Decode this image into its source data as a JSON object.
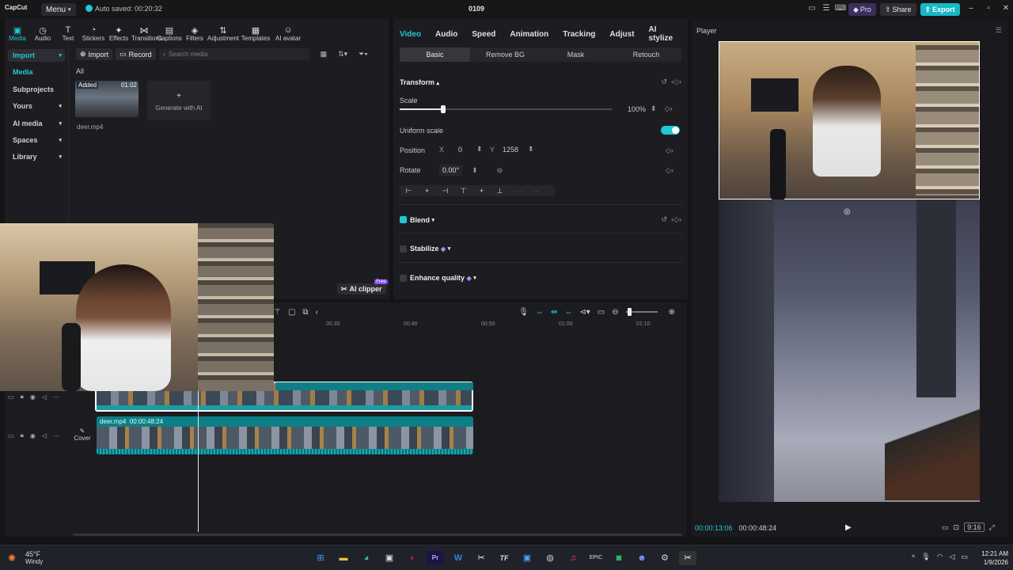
{
  "titlebar": {
    "logo": "CapCut",
    "menu_label": "Menu",
    "autosave": "Auto saved: 00:20:32",
    "project_title": "0109",
    "pro_label": "Pro",
    "share_label": "Share",
    "export_label": "Export"
  },
  "toolbar": [
    {
      "label": "Media",
      "icon": "media-icon"
    },
    {
      "label": "Audio",
      "icon": "audio-icon"
    },
    {
      "label": "Text",
      "icon": "text-icon"
    },
    {
      "label": "Stickers",
      "icon": "stickers-icon"
    },
    {
      "label": "Effects",
      "icon": "effects-icon"
    },
    {
      "label": "Transitions",
      "icon": "transitions-icon"
    },
    {
      "label": "Captions",
      "icon": "captions-icon"
    },
    {
      "label": "Filters",
      "icon": "filters-icon"
    },
    {
      "label": "Adjustment",
      "icon": "adjustment-icon"
    },
    {
      "label": "Templates",
      "icon": "templates-icon"
    },
    {
      "label": "AI avatar",
      "icon": "ai-avatar-icon"
    }
  ],
  "sidenav": {
    "import": "Import",
    "media": "Media",
    "subprojects": "Subprojects",
    "yours": "Yours",
    "ai_media": "AI media",
    "spaces": "Spaces",
    "library": "Library"
  },
  "media": {
    "import_btn": "Import",
    "record_btn": "Record",
    "search_placeholder": "Search media",
    "filter_all": "All",
    "clip_badge": "Added",
    "clip_duration": "01:02",
    "clip_name": "deer.mp4",
    "generate_ai": "Generate with AI",
    "ai_clipper": "AI clipper",
    "free_badge": "Free"
  },
  "props": {
    "tabs": [
      "Video",
      "Audio",
      "Speed",
      "Animation",
      "Tracking",
      "Adjust",
      "AI stylize"
    ],
    "subtabs": [
      "Basic",
      "Remove BG",
      "Mask",
      "Retouch"
    ],
    "transform": "Transform",
    "scale_label": "Scale",
    "scale_value": "100%",
    "uniform_scale": "Uniform scale",
    "position_label": "Position",
    "x_label": "X",
    "x_value": "0",
    "y_label": "Y",
    "y_value": "1258",
    "rotate_label": "Rotate",
    "rotate_value": "0.00°",
    "blend": "Blend",
    "stabilize": "Stabilize",
    "enhance_quality": "Enhance quality"
  },
  "player": {
    "title": "Player",
    "current_time": "00:00:13:06",
    "total_time": "00:00:48:24",
    "ratio": "9:16"
  },
  "timeline": {
    "ruler": [
      "00:30",
      "00:40",
      "00:50",
      "01:00",
      "01:10"
    ],
    "clip_label": "deer.mp4",
    "clip_duration": "00:00:48:24",
    "cover_label": "Cover"
  },
  "taskbar": {
    "temp": "45°F",
    "condition": "Windy",
    "time": "12:21 AM",
    "date": "1/9/2026"
  },
  "colors": {
    "accent": "#1fc9d2",
    "export": "#16b9c6"
  }
}
